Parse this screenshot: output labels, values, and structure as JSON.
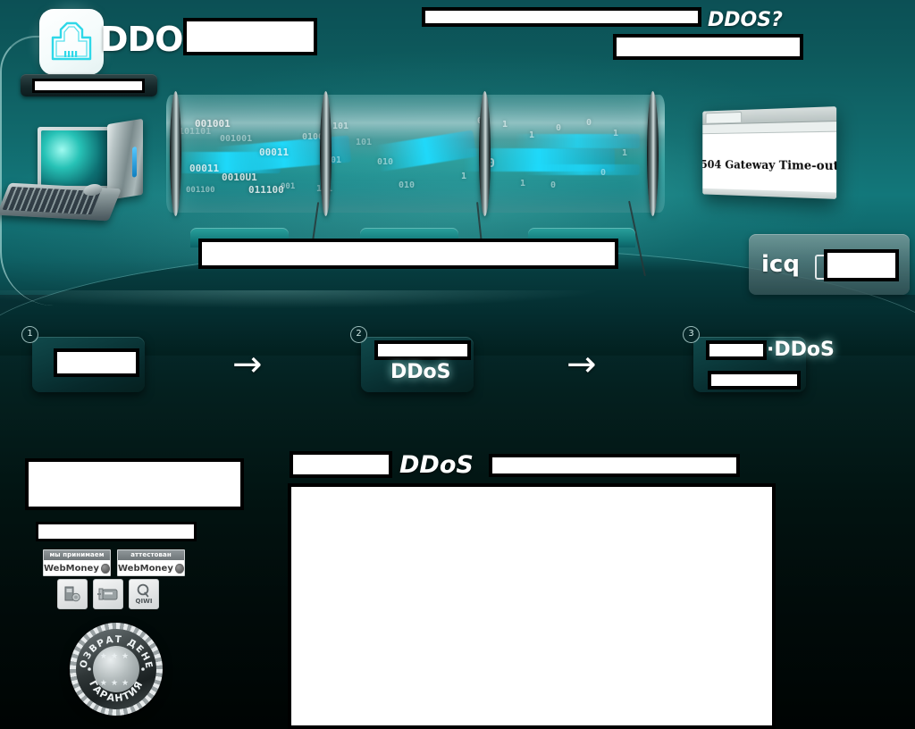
{
  "page": {
    "title_logo_text": "DDOS",
    "accent_teal": "#12777a",
    "accent_cyan": "#2fd8e8",
    "dark_bg": "#03100f"
  },
  "header": {
    "logo_icon": "ethernet-port-icon",
    "logo_word": "DDOS",
    "title_redacted": "",
    "nav_button_redacted": "",
    "tagline_redacted": "",
    "tagline_suffix": "DDOS?",
    "subtagline_redacted": ""
  },
  "hero": {
    "computer_alt": "desktop-computer-illustration",
    "tunnel_bits": [
      "001001",
      "001001",
      "01001",
      "00011",
      "00011",
      "0010U1",
      "001100",
      "011100",
      "101",
      "001",
      "010",
      "001",
      "111",
      "0101",
      "010",
      "101101",
      "01",
      "1",
      "0",
      "1",
      "0"
    ],
    "browser": {
      "error_text": "504 Gateway Time-out"
    },
    "caption_redacted": "",
    "tabs": [
      "",
      "",
      ""
    ],
    "icq": {
      "label": "icq",
      "value_redacted": ""
    }
  },
  "steps": [
    {
      "number": "①",
      "badge": "1",
      "redacted": "",
      "word": ""
    },
    {
      "number": "②",
      "badge": "2",
      "redacted": "",
      "word": "DDoS"
    },
    {
      "number": "③",
      "badge": "3",
      "redacted": "",
      "word": "·DDoS",
      "redacted_2": ""
    }
  ],
  "arrows": {
    "glyph": "→"
  },
  "sidebar": {
    "block_redacted": "",
    "field_redacted": "",
    "webmoney": [
      {
        "caption": "мы принимаем",
        "brand": "WebMoney"
      },
      {
        "caption": "аттестован",
        "brand": "WebMoney"
      }
    ],
    "payment_icons": [
      {
        "name": "cash-terminal-icon",
        "label": ""
      },
      {
        "name": "card-terminal-icon",
        "label": ""
      },
      {
        "name": "qiwi-icon",
        "label": "QIWI"
      }
    ],
    "seal": {
      "top_text": "ВОЗВРАТ ДЕНЕГ",
      "bottom_text": "ГАРАНТИЯ",
      "stars": "★★★"
    }
  },
  "content": {
    "heading_redacted_left": "",
    "heading_word": "DDoS",
    "heading_redacted_right": "",
    "panel_redacted": ""
  }
}
